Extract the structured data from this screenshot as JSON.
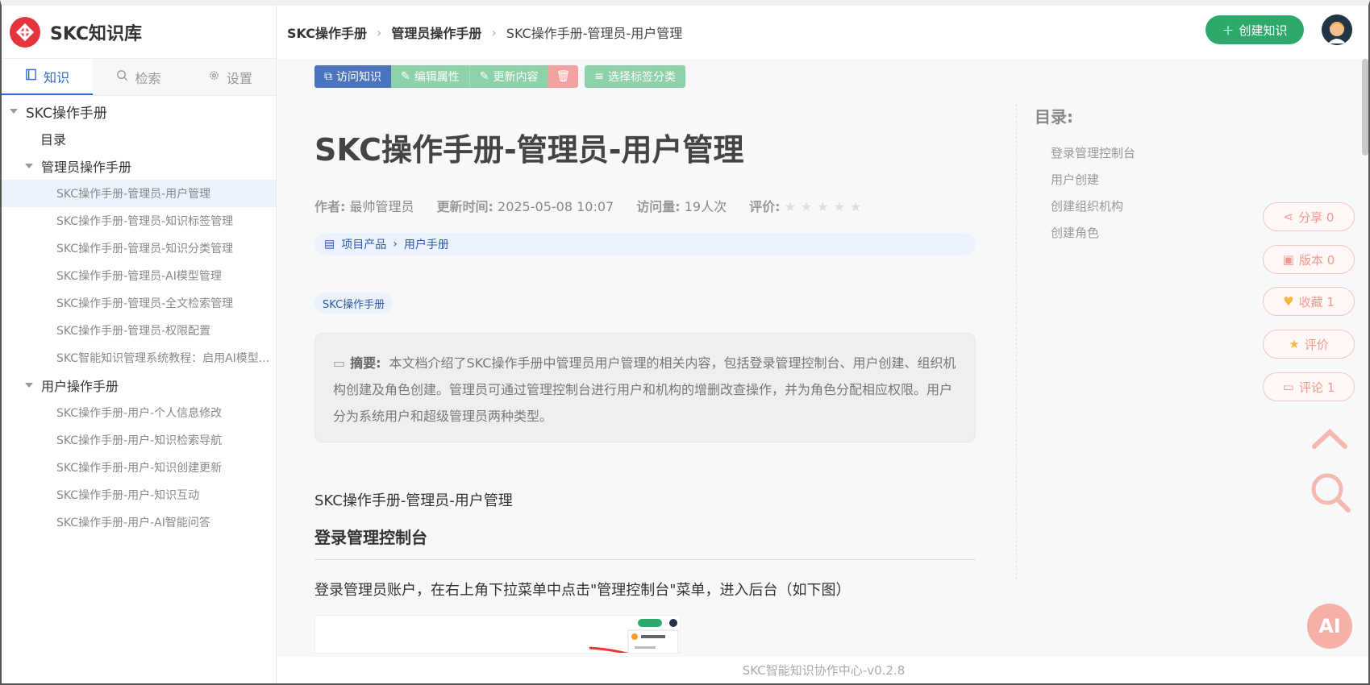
{
  "app": {
    "name": "SKC知识库"
  },
  "sidebar": {
    "tabs": [
      {
        "label": "知识",
        "icon": "book-icon"
      },
      {
        "label": "检索",
        "icon": "search-icon"
      },
      {
        "label": "设置",
        "icon": "gear-icon"
      }
    ],
    "tree": [
      {
        "label": "SKC操作手册",
        "level": 0
      },
      {
        "label": "目录",
        "level": 1
      },
      {
        "label": "管理员操作手册",
        "level": 1
      },
      {
        "label": "SKC操作手册-管理员-用户管理",
        "level": 2,
        "selected": true
      },
      {
        "label": "SKC操作手册-管理员-知识标签管理",
        "level": 2
      },
      {
        "label": "SKC操作手册-管理员-知识分类管理",
        "level": 2
      },
      {
        "label": "SKC操作手册-管理员-AI模型管理",
        "level": 2
      },
      {
        "label": "SKC操作手册-管理员-全文检索管理",
        "level": 2
      },
      {
        "label": "SKC操作手册-管理员-权限配置",
        "level": 2
      },
      {
        "label": "SKC智能知识管理系统教程：启用AI模型...",
        "level": 2
      },
      {
        "label": "用户操作手册",
        "level": 1
      },
      {
        "label": "SKC操作手册-用户-个人信息修改",
        "level": 2
      },
      {
        "label": "SKC操作手册-用户-知识检索导航",
        "level": 2
      },
      {
        "label": "SKC操作手册-用户-知识创建更新",
        "level": 2
      },
      {
        "label": "SKC操作手册-用户-知识互动",
        "level": 2
      },
      {
        "label": "SKC操作手册-用户-AI智能问答",
        "level": 2
      }
    ]
  },
  "header": {
    "breadcrumb": [
      "SKC操作手册",
      "管理员操作手册",
      "SKC操作手册-管理员-用户管理"
    ],
    "create_label": "创建知识"
  },
  "toolbar": {
    "visit": "访问知识",
    "edit": "编辑属性",
    "update": "更新内容",
    "tag": "选择标签分类"
  },
  "doc": {
    "title": "SKC操作手册-管理员-用户管理",
    "author_label": "作者:",
    "author": "最帅管理员",
    "updated_label": "更新时间:",
    "updated": "2025-05-08 10:07",
    "views_label": "访问量:",
    "views": "19人次",
    "rating_label": "评价:",
    "rating": 0,
    "path": [
      "项目产品",
      "用户手册"
    ],
    "tag": "SKC操作手册",
    "summary_label": "摘要:",
    "summary": "本文档介绍了SKC操作手册中管理员用户管理的相关内容，包括登录管理控制台、用户创建、组织机构创建及角色创建。管理员可通过管理控制台进行用户和机构的增删改查操作，并为角色分配相应权限。用户分为系统用户和超级管理员两种类型。",
    "content_title": "SKC操作手册-管理员-用户管理",
    "section_heading": "登录管理控制台",
    "section_text": "登录管理员账户，在右上角下拉菜单中点击\"管理控制台\"菜单，进入后台（如下图）"
  },
  "toc": {
    "title": "目录:",
    "items": [
      "登录管理控制台",
      "用户创建",
      "创建组织机构",
      "创建角色"
    ]
  },
  "actions": {
    "share": "分享 0",
    "version": "版本 0",
    "favorite": "收藏 1",
    "rate": "评价",
    "comment": "评论 1",
    "ai": "AI"
  },
  "footer": {
    "text": "SKC智能知识协作中心-v0.2.8"
  }
}
